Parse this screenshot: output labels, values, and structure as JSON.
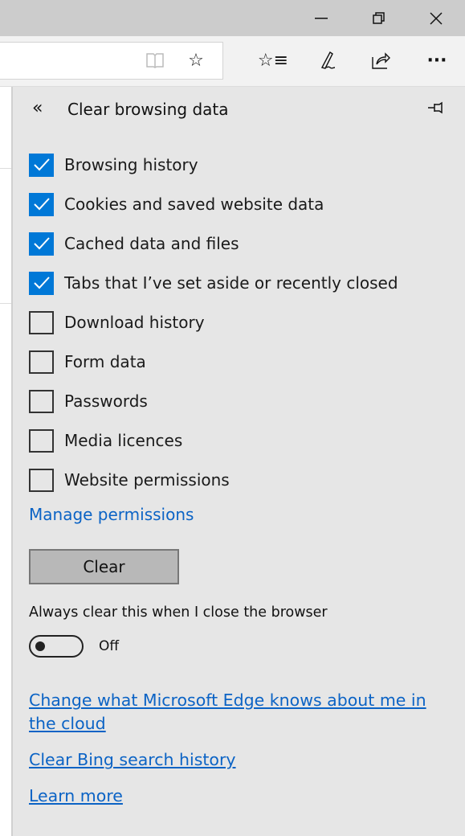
{
  "window": {
    "minimize_icon": "minimize-icon",
    "restore_icon": "restore-icon",
    "close_icon": "close-icon"
  },
  "toolbar": {
    "reading_view_icon": "book-icon",
    "favorite_icon": "star-icon",
    "hub_icon": "favorites-list-icon",
    "notes_icon": "pen-icon",
    "share_icon": "share-icon",
    "more_label": "···"
  },
  "panel": {
    "back_glyph": "«",
    "title": "Clear browsing data",
    "pin_icon": "pin-icon",
    "options": [
      {
        "label": "Browsing history",
        "checked": true
      },
      {
        "label": "Cookies and saved website data",
        "checked": true
      },
      {
        "label": "Cached data and files",
        "checked": true
      },
      {
        "label": "Tabs that I’ve set aside or recently closed",
        "checked": true
      },
      {
        "label": "Download history",
        "checked": false
      },
      {
        "label": "Form data",
        "checked": false
      },
      {
        "label": "Passwords",
        "checked": false
      },
      {
        "label": "Media licences",
        "checked": false
      },
      {
        "label": "Website permissions",
        "checked": false
      }
    ],
    "manage_permissions": "Manage permissions",
    "clear_button": "Clear",
    "always_clear_label": "Always clear this when I close the browser",
    "toggle_state": "Off",
    "links": {
      "cloud": "Change what Microsoft Edge knows about me in the cloud",
      "bing": "Clear Bing search history",
      "learn": "Learn more"
    },
    "accent_color": "#0078d7",
    "link_color": "#0b63c5"
  }
}
